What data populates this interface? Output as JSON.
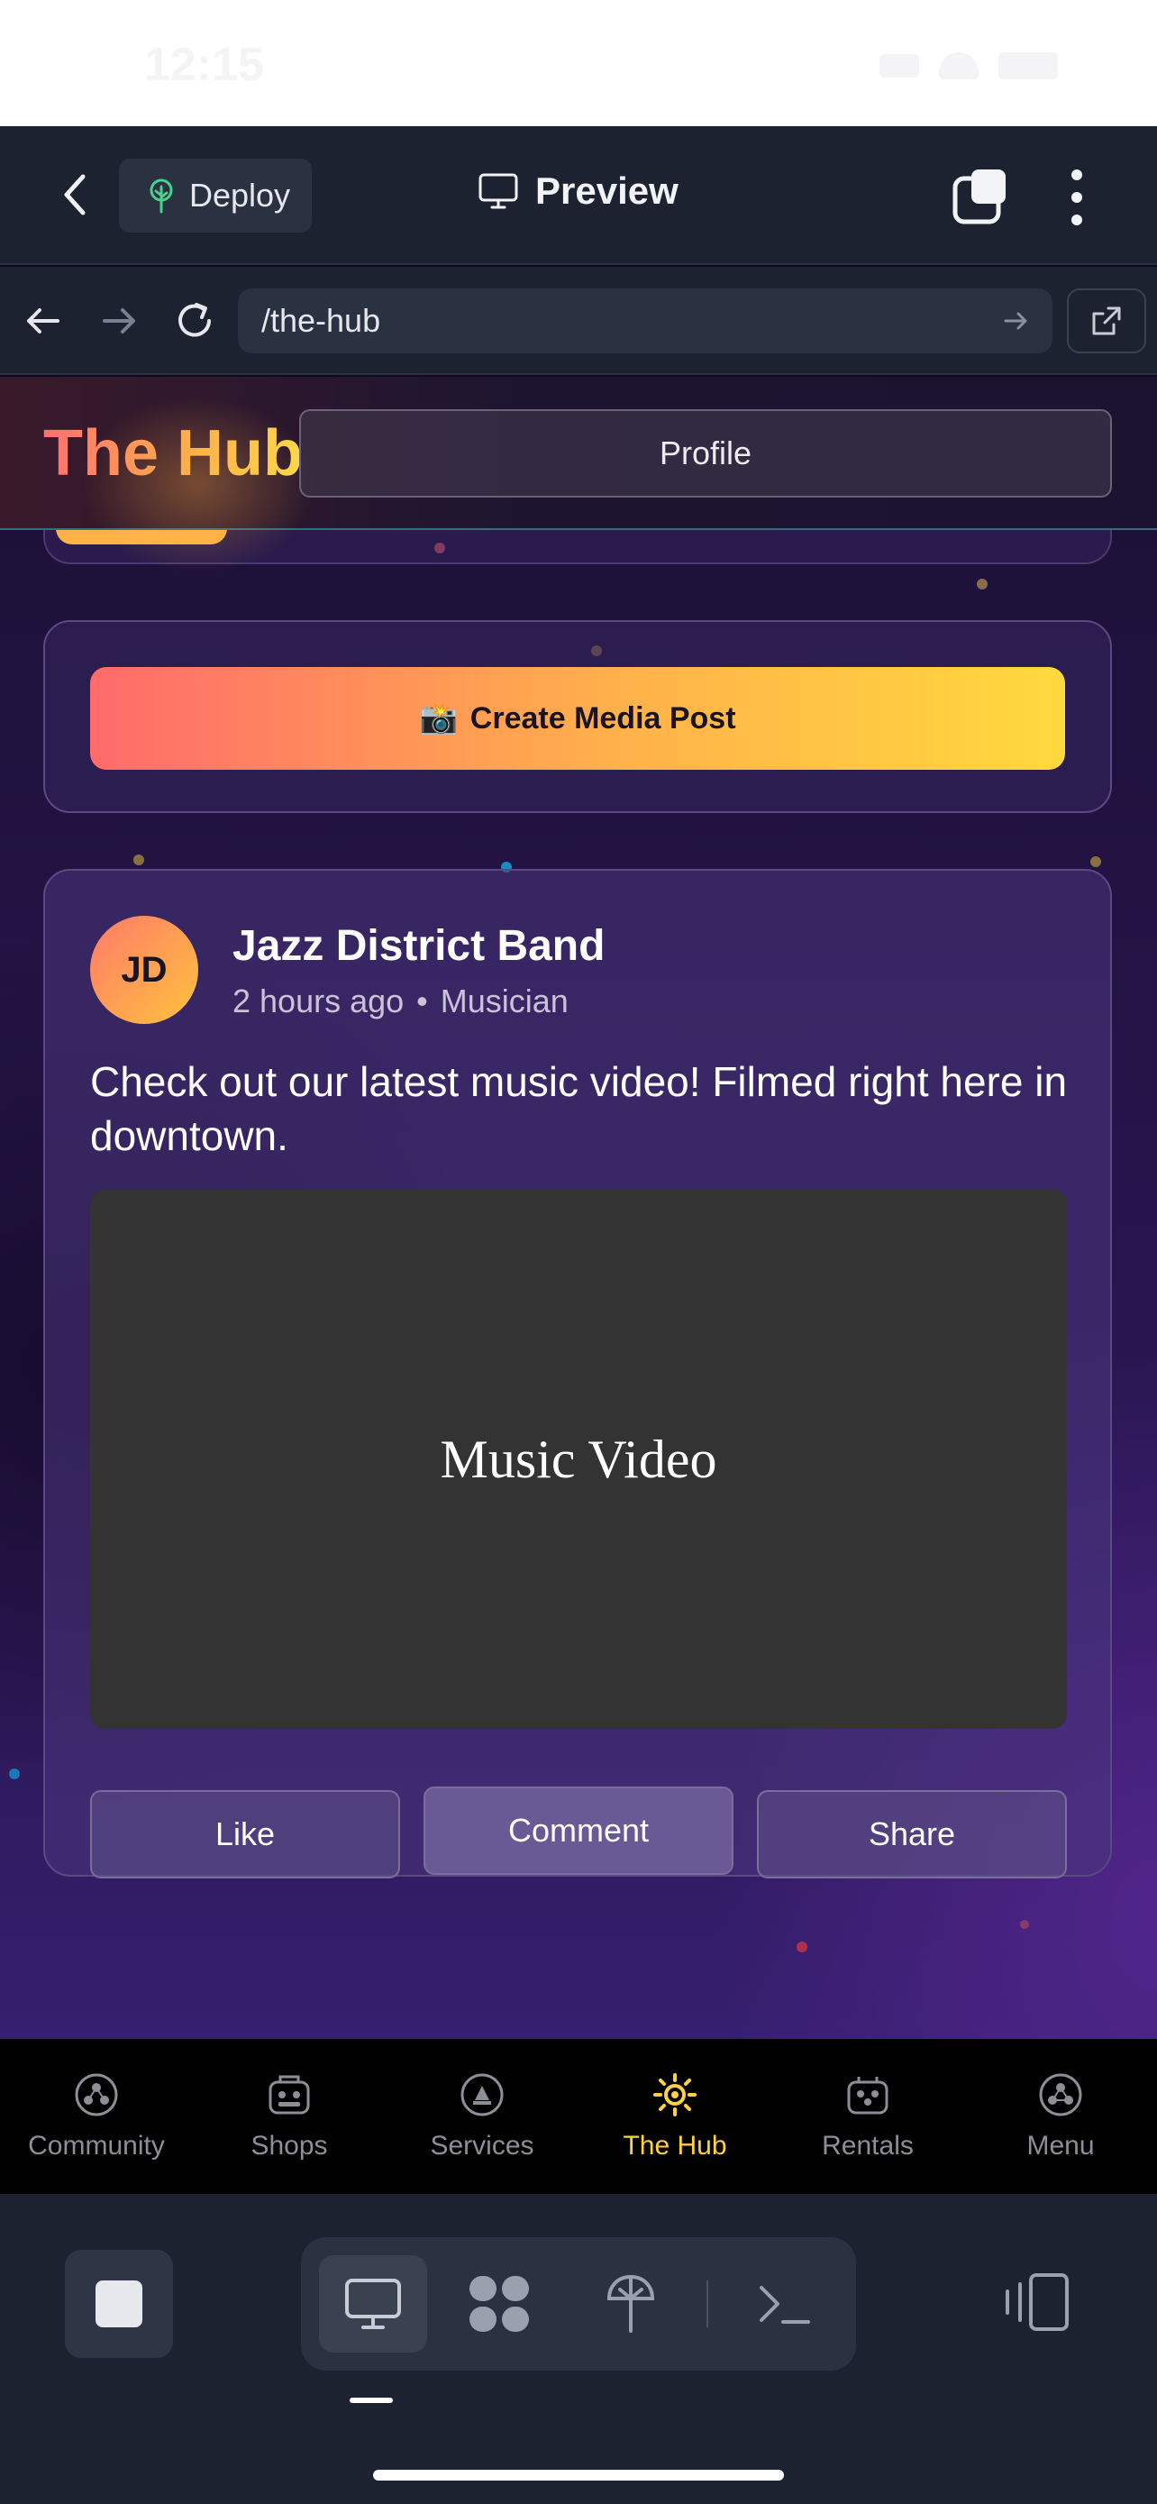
{
  "status_bar": {
    "time": "12:15"
  },
  "app_bar": {
    "deploy_label": "Deploy",
    "preview_label": "Preview",
    "icons": [
      "chevron-left-icon",
      "tree-icon",
      "monitor-icon",
      "tabs-icon",
      "more-vertical-icon"
    ]
  },
  "browser_nav": {
    "url": "/the-hub",
    "icons": [
      "arrow-left-icon",
      "arrow-right-icon",
      "reload-icon",
      "arrow-go-icon",
      "external-link-icon"
    ]
  },
  "hub": {
    "title": "The Hub",
    "profile_label": "Profile",
    "create_post_emoji": "📸",
    "create_post_label": "Create Media Post"
  },
  "post": {
    "avatar_initials": "JD",
    "author": "Jazz District Band",
    "time_ago": "2 hours ago",
    "separator": "•",
    "role": "Musician",
    "text": "Check out our latest music video! Filmed right here in downtown.",
    "media_label": "Music Video",
    "actions": {
      "like": "Like",
      "comment": "Comment",
      "share": "Share"
    }
  },
  "tab_bar": {
    "items": [
      {
        "label": "Community",
        "icon": "community-icon"
      },
      {
        "label": "Shops",
        "icon": "shop-icon"
      },
      {
        "label": "Services",
        "icon": "services-icon"
      },
      {
        "label": "The Hub",
        "icon": "hub-sun-icon",
        "active": true
      },
      {
        "label": "Rentals",
        "icon": "rentals-icon"
      },
      {
        "label": "Menu",
        "icon": "menu-icon"
      }
    ],
    "active_color": "#ffd23d",
    "inactive_color": "#8e8e96"
  },
  "colors": {
    "brand_gradient_start": "#ff6b6b",
    "brand_gradient_end": "#ffd93d",
    "chrome_bg": "#1c2230",
    "media_bg": "#333333"
  }
}
